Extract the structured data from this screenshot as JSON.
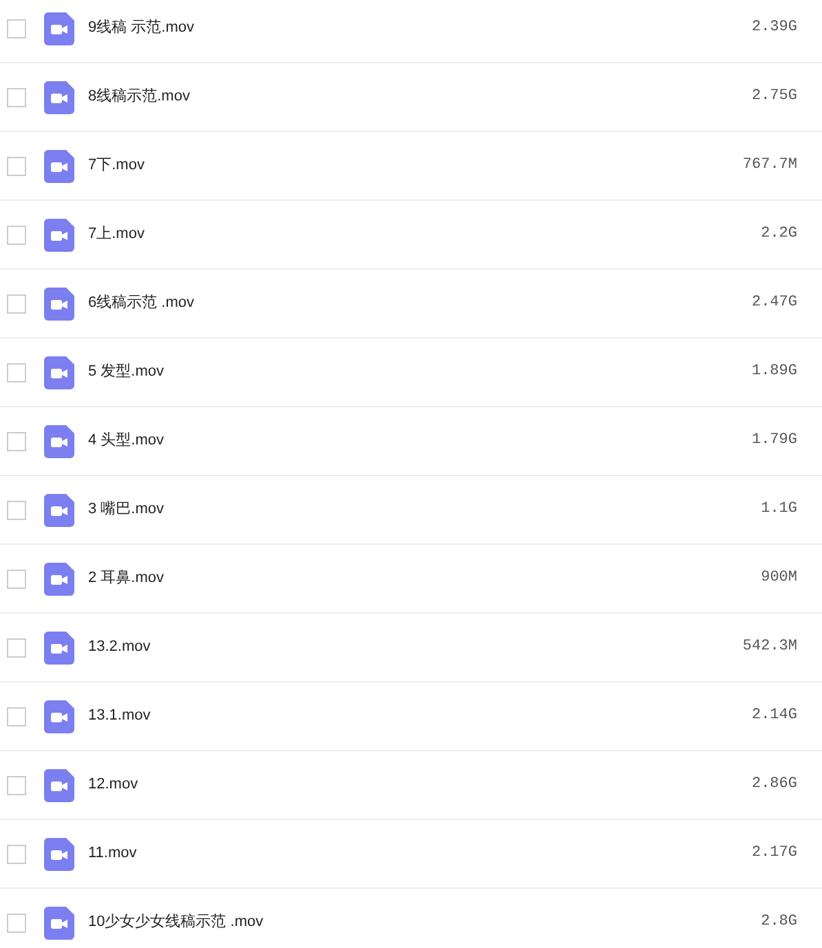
{
  "files": [
    {
      "name": "9线稿 示范.mov",
      "size": "2.39G",
      "checked": false
    },
    {
      "name": "8线稿示范.mov",
      "size": "2.75G",
      "checked": false
    },
    {
      "name": "7下.mov",
      "size": "767.7M",
      "checked": false
    },
    {
      "name": "7上.mov",
      "size": "2.2G",
      "checked": false
    },
    {
      "name": "6线稿示范 .mov",
      "size": "2.47G",
      "checked": false
    },
    {
      "name": "5 发型.mov",
      "size": "1.89G",
      "checked": false
    },
    {
      "name": "4 头型.mov",
      "size": "1.79G",
      "checked": false
    },
    {
      "name": "3 嘴巴.mov",
      "size": "1.1G",
      "checked": false
    },
    {
      "name": "2 耳鼻.mov",
      "size": "900M",
      "checked": false
    },
    {
      "name": "13.2.mov",
      "size": "542.3M",
      "checked": false
    },
    {
      "name": "13.1.mov",
      "size": "2.14G",
      "checked": false
    },
    {
      "name": "12.mov",
      "size": "2.86G",
      "checked": false
    },
    {
      "name": "11.mov",
      "size": "2.17G",
      "checked": false
    },
    {
      "name": "10少女少女线稿示范 .mov",
      "size": "2.8G",
      "checked": false
    }
  ]
}
